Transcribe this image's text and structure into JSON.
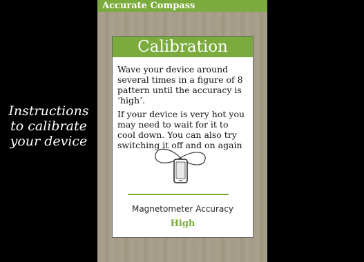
{
  "caption": {
    "line1": "Instructions",
    "line2": "to calibrate",
    "line3": "your device"
  },
  "app": {
    "title": "Accurate Compass"
  },
  "dialog": {
    "title": "Calibration",
    "paragraph1": "Wave your device around several times in a figure of 8 pattern until the accuracy is ‘high’.",
    "paragraph2": "If your device is very hot you may need to wait for it to cool down. You can also try switching it off and on again",
    "illustration_icon": "figure-eight-phone-icon",
    "accuracy_label": "Magnetometer Accuracy",
    "accuracy_value": "High"
  },
  "colors": {
    "accent": "#7aab3c"
  }
}
